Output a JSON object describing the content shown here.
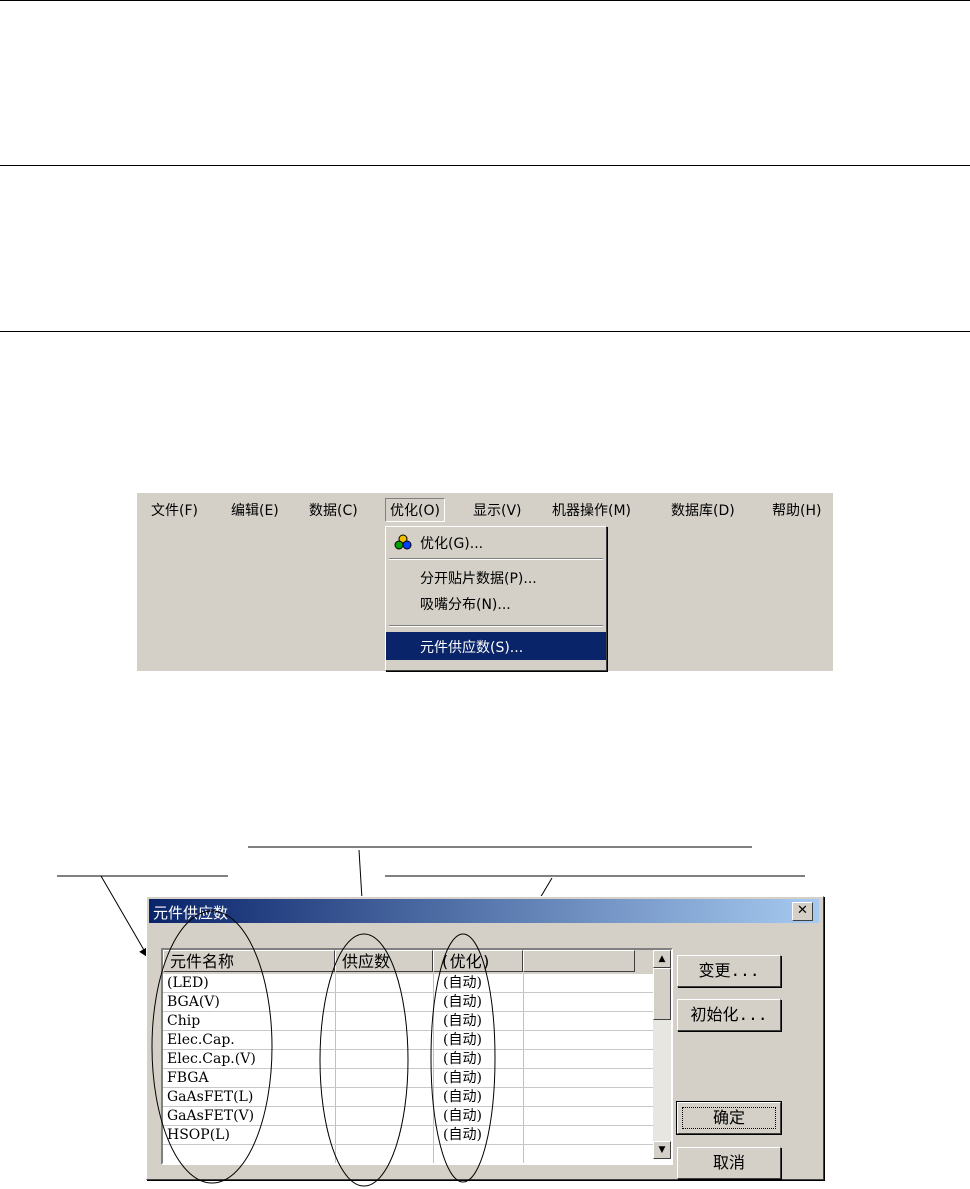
{
  "menubar": {
    "items": [
      "文件(F)",
      "编辑(E)",
      "数据(C)",
      "优化(O)",
      "显示(V)",
      "机器操作(M)",
      "数据库(D)",
      "帮助(H)"
    ],
    "open_item": "优化(O)"
  },
  "dropdown": {
    "items": [
      {
        "label": "优化(G)...",
        "icon": "optimize-icon"
      },
      {
        "label": "分开贴片数据(P)..."
      },
      {
        "label": "吸嘴分布(N)..."
      },
      {
        "label": "元件供应数(S)...",
        "selected": true
      }
    ]
  },
  "dialog": {
    "title": "元件供应数",
    "columns": [
      "元件名称",
      "供应数",
      "(优化)"
    ],
    "rows": [
      {
        "name": "(LED)",
        "supply": "",
        "opt": "(自动)"
      },
      {
        "name": "BGA(V)",
        "supply": "",
        "opt": "(自动)"
      },
      {
        "name": "Chip",
        "supply": "",
        "opt": "(自动)"
      },
      {
        "name": "Elec.Cap.",
        "supply": "",
        "opt": "(自动)"
      },
      {
        "name": "Elec.Cap.(V)",
        "supply": "",
        "opt": "(自动)"
      },
      {
        "name": "FBGA",
        "supply": "",
        "opt": "(自动)"
      },
      {
        "name": "GaAsFET(L)",
        "supply": "",
        "opt": "(自动)"
      },
      {
        "name": "GaAsFET(V)",
        "supply": "",
        "opt": "(自动)"
      },
      {
        "name": "HSOP(L)",
        "supply": "",
        "opt": "(自动)"
      }
    ],
    "buttons": {
      "change": "变更...",
      "init": "初始化...",
      "ok": "确定",
      "cancel": "取消"
    },
    "close_glyph": "✕"
  },
  "colors": {
    "face": "#d4d0c8",
    "highlight": "#0a246a"
  }
}
